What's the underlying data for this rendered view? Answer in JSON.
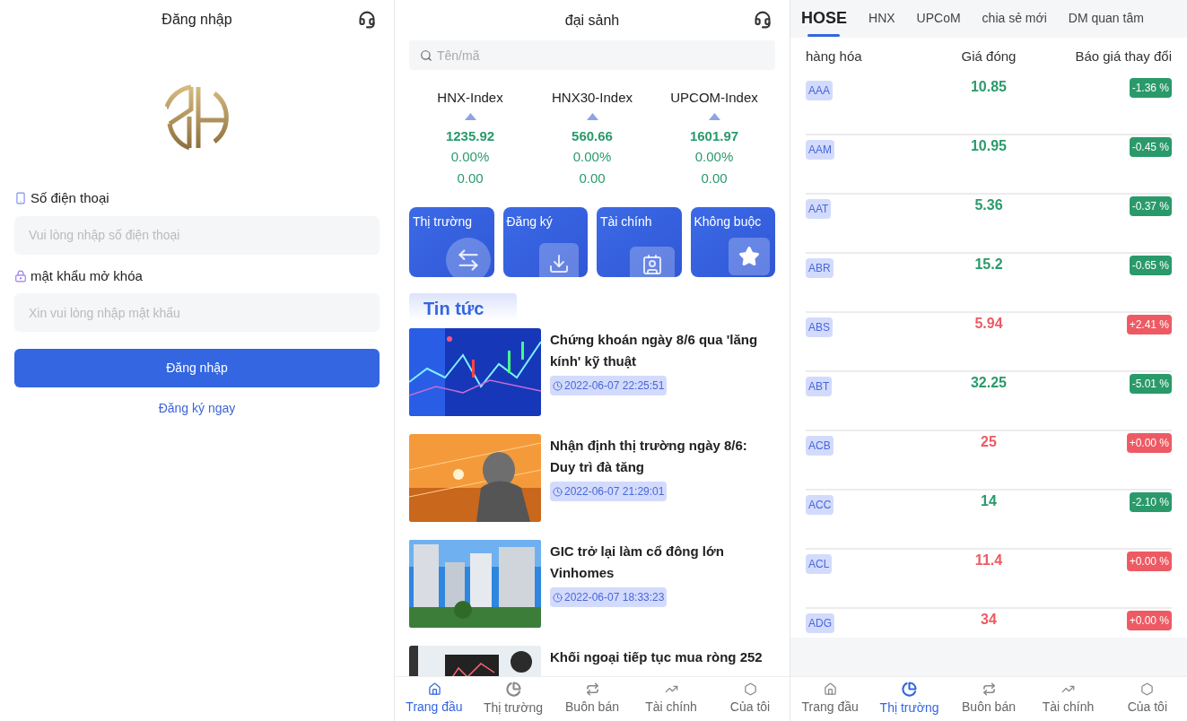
{
  "login": {
    "title": "Đăng nhập",
    "phone_label": "Số điện thoại",
    "phone_placeholder": "Vui lòng nhập số điện thoại",
    "password_label": "mật khẩu mở khóa",
    "password_placeholder": "Xin vui lòng nhập mật khẩu",
    "submit": "Đăng nhập",
    "register_link": "Đăng ký ngay"
  },
  "home": {
    "title": "đại sảnh",
    "search_placeholder": "Tên/mã",
    "indices": [
      {
        "name": "HNX-Index",
        "value": "1235.92",
        "percent": "0.00%",
        "change": "0.00"
      },
      {
        "name": "HNX30-Index",
        "value": "560.66",
        "percent": "0.00%",
        "change": "0.00"
      },
      {
        "name": "UPCOM-Index",
        "value": "1601.97",
        "percent": "0.00%",
        "change": "0.00"
      }
    ],
    "shortcuts": [
      {
        "label": "Thị trường",
        "kind": "exchange"
      },
      {
        "label": "Đăng ký",
        "kind": "download"
      },
      {
        "label": "Tài chính",
        "kind": "card"
      },
      {
        "label": "Không buộc",
        "kind": "star"
      }
    ],
    "news_heading": "Tin tức",
    "news": [
      {
        "title": "Chứng khoán ngày 8/6 qua 'lăng kính' kỹ thuật",
        "time": "2022-06-07 22:25:51",
        "kind": "chart"
      },
      {
        "title": "Nhận định thị trường ngày 8/6: Duy trì đà tăng",
        "time": "2022-06-07 21:29:01",
        "kind": "statue"
      },
      {
        "title": "GIC trở lại làm cổ đông lớn Vinhomes",
        "time": "2022-06-07 18:33:23",
        "kind": "buildings"
      },
      {
        "title": "Khối ngoại tiếp tục mua ròng 252",
        "kind": "office"
      }
    ],
    "nav": [
      {
        "label": "Trang đầu",
        "kind": "home",
        "selected": true
      },
      {
        "label": "Thị trường",
        "kind": "pie",
        "selected": false
      },
      {
        "label": "Buôn bán",
        "kind": "trade",
        "selected": false
      },
      {
        "label": "Tài chính",
        "kind": "finance",
        "selected": false
      },
      {
        "label": "Của tôi",
        "kind": "me",
        "selected": false
      }
    ]
  },
  "market": {
    "tabs": [
      {
        "label": "HOSE",
        "selected": true
      },
      {
        "label": "HNX",
        "selected": false
      },
      {
        "label": "UPCoM",
        "selected": false
      },
      {
        "label": "chia sẻ mới",
        "selected": false
      },
      {
        "label": "DM quan tâm",
        "selected": false
      }
    ],
    "columns": [
      "hàng hóa",
      "Giá đóng",
      "Báo giá thay đổi"
    ],
    "rows": [
      {
        "ticker": "AAA",
        "price": "10.85",
        "change": "-1.36 %",
        "color": "#2a9a6b"
      },
      {
        "ticker": "AAM",
        "price": "10.95",
        "change": "-0.45 %",
        "color": "#2a9a6b"
      },
      {
        "ticker": "AAT",
        "price": "5.36",
        "change": "-0.37 %",
        "color": "#2a9a6b"
      },
      {
        "ticker": "ABR",
        "price": "15.2",
        "change": "-0.65 %",
        "color": "#2a9a6b"
      },
      {
        "ticker": "ABS",
        "price": "5.94",
        "change": "+2.41 %",
        "color": "#ee5a64"
      },
      {
        "ticker": "ABT",
        "price": "32.25",
        "change": "-5.01 %",
        "color": "#2a9a6b"
      },
      {
        "ticker": "ACB",
        "price": "25",
        "change": "+0.00 %",
        "color": "#ee5a64"
      },
      {
        "ticker": "ACC",
        "price": "14",
        "change": "-2.10 %",
        "color": "#2a9a6b"
      },
      {
        "ticker": "ACL",
        "price": "11.4",
        "change": "+0.00 %",
        "color": "#ee5a64"
      },
      {
        "ticker": "ADG",
        "price": "34",
        "change": "+0.00 %",
        "color": "#ee5a64"
      }
    ],
    "nav": [
      {
        "label": "Trang đầu",
        "kind": "home",
        "selected": false
      },
      {
        "label": "Thị trường",
        "kind": "pie",
        "selected": true
      },
      {
        "label": "Buôn bán",
        "kind": "trade",
        "selected": false
      },
      {
        "label": "Tài chính",
        "kind": "finance",
        "selected": false
      },
      {
        "label": "Của tôi",
        "kind": "me",
        "selected": false
      }
    ]
  }
}
